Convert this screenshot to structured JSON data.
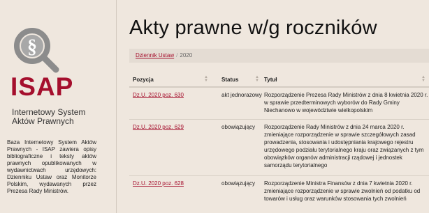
{
  "sidebar": {
    "logo_text": "ISAP",
    "logo_sub_line1": "Internetowy System",
    "logo_sub_line2": "Aktów Prawnych",
    "description": "Baza Internetowy System Aktów Prawnych - ISAP zawiera opisy bibliograficzne i teksty aktów prawnych opublikowanych w wydawnictwach urzędowych: Dzienniku Ustaw oraz Monitorze Polskim, wydawanych przez Prezesa Rady Ministrów.",
    "brand_color": "#a50f2d"
  },
  "main": {
    "title": "Akty prawne w/g roczników",
    "breadcrumb": {
      "link": "Dziennik Ustaw",
      "separator": "/",
      "current": "2020"
    },
    "table": {
      "headers": {
        "position": "Pozycja",
        "status": "Status",
        "title": "Tytuł"
      },
      "rows": [
        {
          "position": "Dz.U. 2020 poz. 630",
          "status": "akt jednorazowy",
          "title": "Rozporządzenie Prezesa Rady Ministrów z dnia 8 kwietnia 2020 r. w sprawie przedterminowych wyborów do Rady Gminy Niechanowo w województwie wielkopolskim"
        },
        {
          "position": "Dz.U. 2020 poz. 629",
          "status": "obowiązujący",
          "title": "Rozporządzenie Rady Ministrów z dnia 24 marca 2020 r. zmieniające rozporządzenie w sprawie szczegółowych zasad prowadzenia, stosowania i udostępniania krajowego rejestru urzędowego podziału terytorialnego kraju oraz związanych z tym obowiązków organów administracji rządowej i jednostek samorządu terytorialnego"
        },
        {
          "position": "Dz.U. 2020 poz. 628",
          "status": "obowiązujący",
          "title": "Rozporządzenie Ministra Finansów z dnia 7 kwietnia 2020 r. zmieniające rozporządzenie w sprawie zwolnień od podatku od towarów i usług oraz warunków stosowania tych zwolnień"
        }
      ]
    }
  }
}
